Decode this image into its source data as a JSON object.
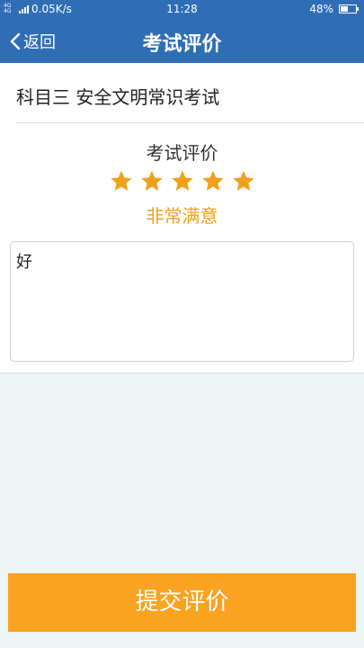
{
  "status_bar": {
    "network_type": "4G 4G",
    "speed": "0.05K/s",
    "time": "11:28",
    "battery_percent": "48%",
    "battery_level": 0.48
  },
  "nav": {
    "back_label": "返回",
    "title": "考试评价"
  },
  "exam": {
    "name": "科目三 安全文明常识考试"
  },
  "rating": {
    "title": "考试评价",
    "stars": 5,
    "max_stars": 5,
    "label": "非常满意",
    "star_color": "#f0a11a"
  },
  "comment": {
    "value": "好"
  },
  "submit": {
    "label": "提交评价",
    "color": "#f9a320"
  },
  "colors": {
    "header": "#2f6eb5",
    "background": "#eef5f6"
  }
}
